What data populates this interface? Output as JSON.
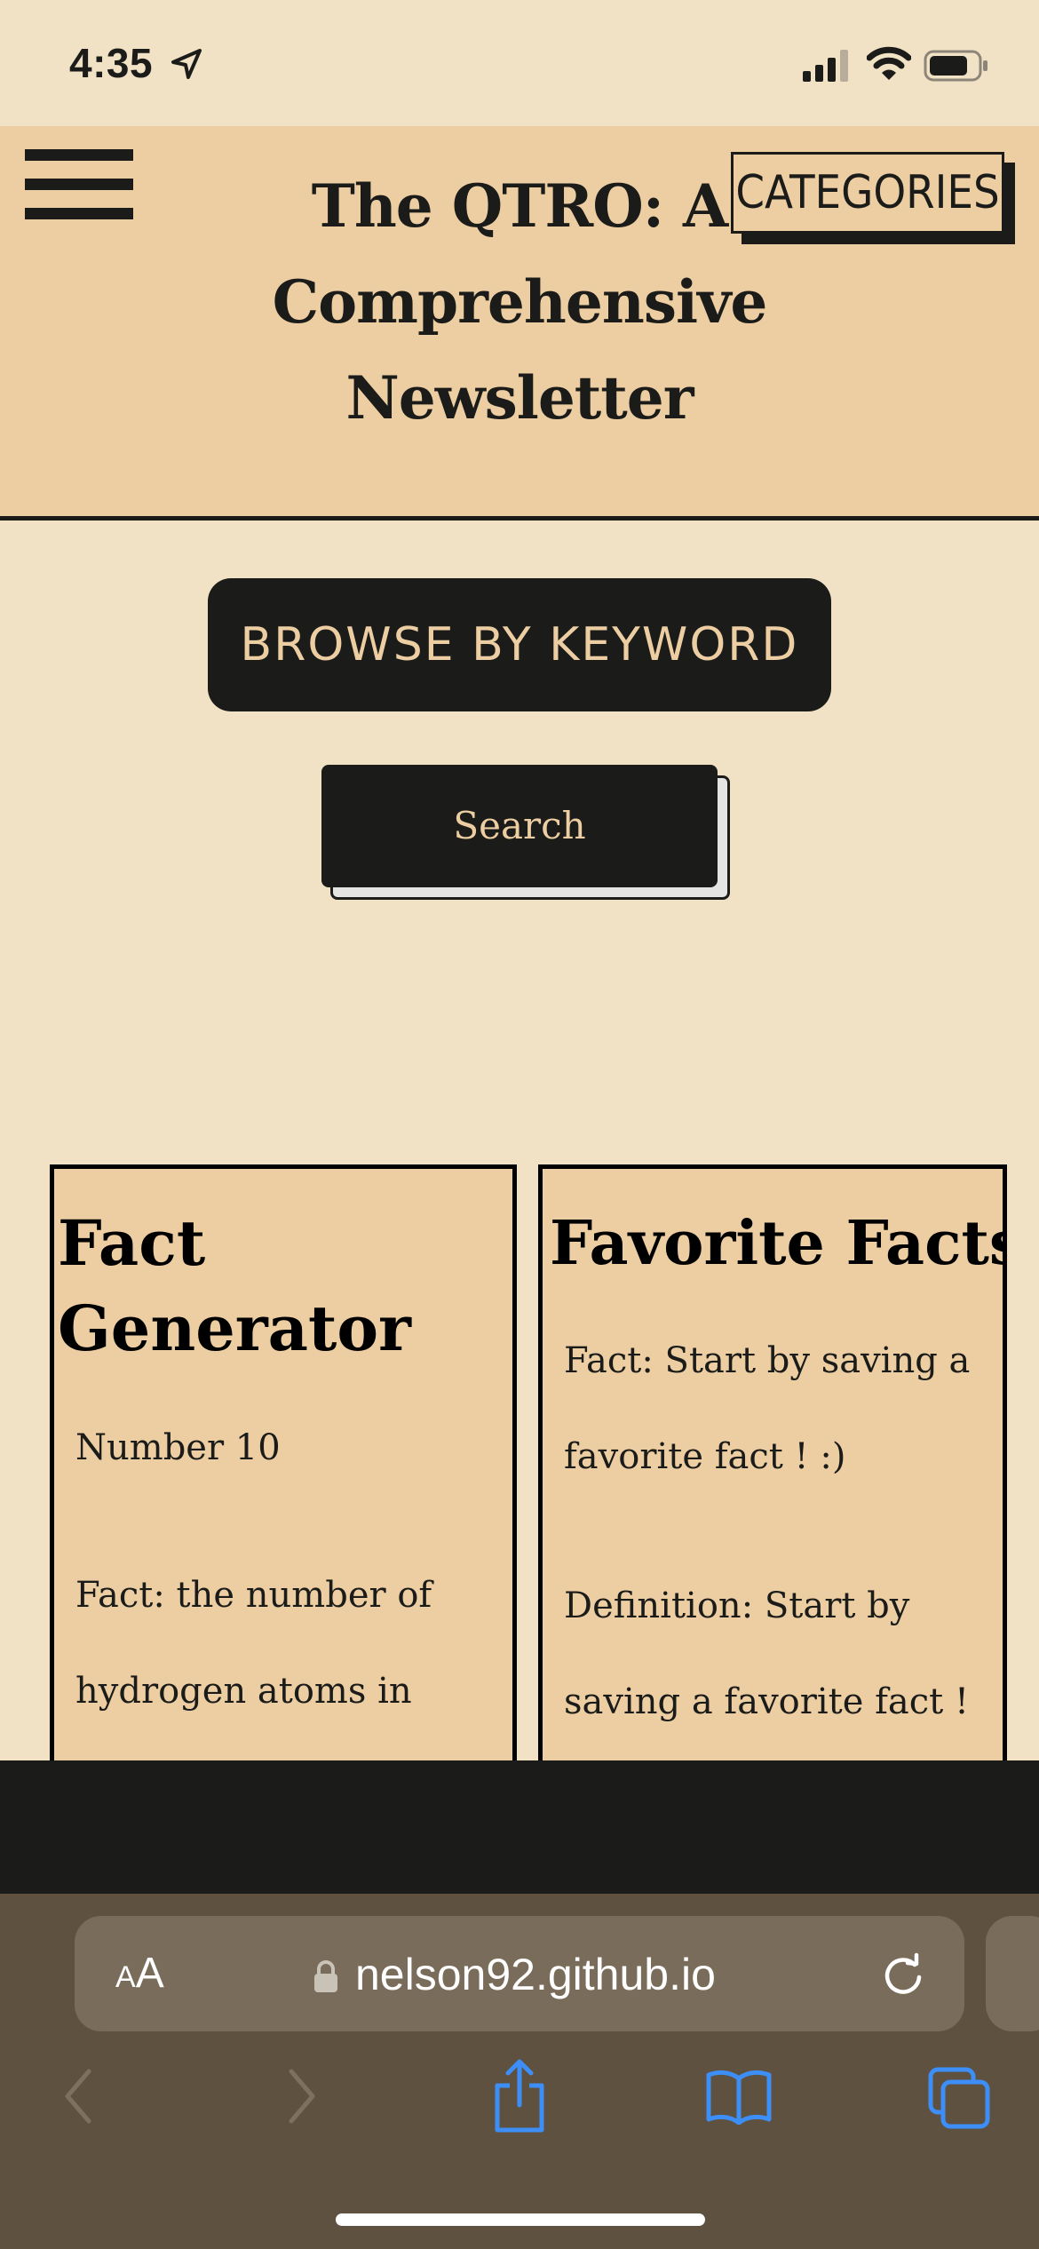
{
  "status_bar": {
    "time": "4:35",
    "icons": [
      "location-arrow-icon",
      "cellular-signal-icon",
      "wifi-icon",
      "battery-icon"
    ]
  },
  "header": {
    "title_lines": [
      "The QTRO: A",
      "Comprehensive",
      "Newsletter"
    ],
    "categories_label": "CATEGORIES",
    "menu_icon": "hamburger-menu-icon"
  },
  "main": {
    "browse_label": "BROWSE BY KEYWORD",
    "search_label": "Search"
  },
  "fact_generator": {
    "title_lines": [
      "Fact",
      "Generator"
    ],
    "number": "Number 10",
    "fact_lines": [
      "Fact: the number of",
      "hydrogen atoms in"
    ]
  },
  "favorite_facts": {
    "title": "Favorite Facts",
    "fact_lines": [
      "Fact: Start by saving a",
      "favorite fact ! :)"
    ],
    "definition_lines": [
      "Definition: Start by",
      "saving a favorite fact !"
    ]
  },
  "browser": {
    "text_size_label_small": "A",
    "text_size_label_large": "A",
    "url": "nelson92.github.io",
    "icons": [
      "back-icon",
      "forward-icon",
      "share-icon",
      "bookmarks-icon",
      "tabs-icon"
    ]
  },
  "colors": {
    "background": "#f1e2c6",
    "header_bg": "#edcea2",
    "dark": "#1b1c1a",
    "accent_text": "#edcea2",
    "safari_bar": "#5e5140",
    "safari_icon_blue": "#3d8ef7"
  }
}
